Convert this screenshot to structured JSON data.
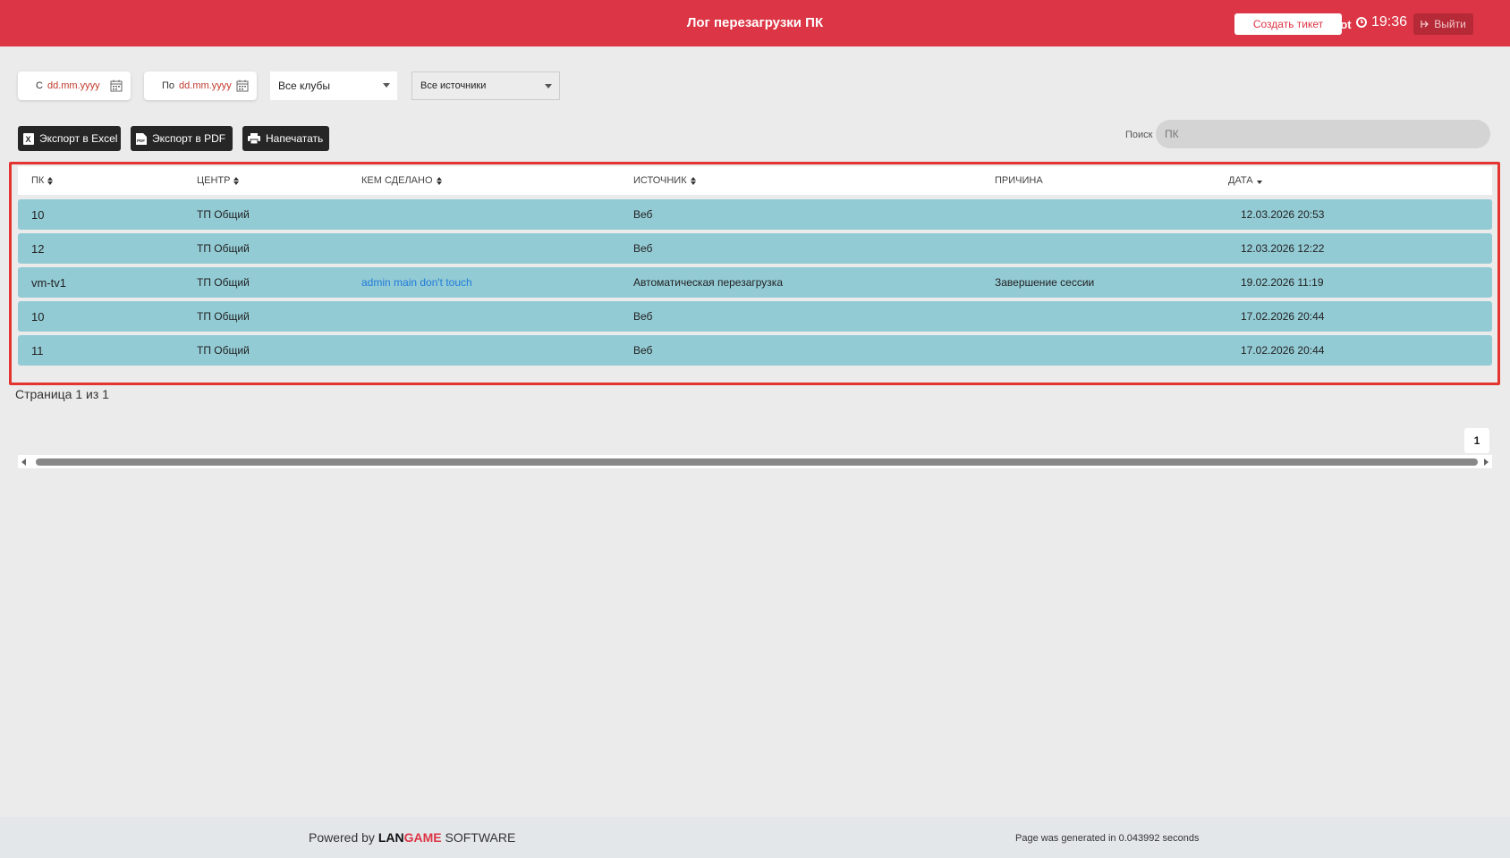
{
  "header": {
    "title": "Лог перезагрузки ПК",
    "create_ticket": "Создать тикет",
    "user": "Root",
    "time": "19:36",
    "logout": "Выйти"
  },
  "filters": {
    "from_label": "С",
    "from_placeholder": "dd.mm.yyyy",
    "to_label": "По",
    "to_placeholder": "dd.mm.yyyy",
    "clubs": "Все клубы",
    "sources": "Все источники"
  },
  "actions": {
    "excel": "Экспорт в Excel",
    "pdf": "Экспорт в PDF",
    "print": "Напечатать"
  },
  "search": {
    "label": "Поиск",
    "placeholder": "ПК"
  },
  "table": {
    "columns": [
      "ПК",
      "ЦЕНТР",
      "КЕМ СДЕЛАНО",
      "ИСТОЧНИК",
      "ПРИЧИНА",
      "ДАТА"
    ],
    "rows": [
      {
        "pk": "10",
        "center": "ТП Общий",
        "by": "",
        "source": "Веб",
        "reason": "",
        "date": "12.03.2026 20:53"
      },
      {
        "pk": "12",
        "center": "ТП Общий",
        "by": "",
        "source": "Веб",
        "reason": "",
        "date": "12.03.2026 12:22"
      },
      {
        "pk": "vm-tv1",
        "center": "ТП Общий",
        "by": "admin main don't touch",
        "source": "Автоматическая перезагрузка",
        "reason": "Завершение сессии",
        "date": "19.02.2026 11:19"
      },
      {
        "pk": "10",
        "center": "ТП Общий",
        "by": "",
        "source": "Веб",
        "reason": "",
        "date": "17.02.2026 20:44"
      },
      {
        "pk": "11",
        "center": "ТП Общий",
        "by": "",
        "source": "Веб",
        "reason": "",
        "date": "17.02.2026 20:44"
      }
    ]
  },
  "pagination": {
    "info": "Страница 1 из 1",
    "current": "1"
  },
  "footer": {
    "powered_by": "Powered by",
    "brand_lan": "LAN",
    "brand_game": "GAME",
    "brand_software": "SOFTWARE",
    "generated": "Page was generated in 0.043992 seconds"
  },
  "colors": {
    "header": "#dc3545",
    "row": "#93cbd5",
    "highlight_frame": "#e3342f",
    "link": "#1f7ad8"
  }
}
